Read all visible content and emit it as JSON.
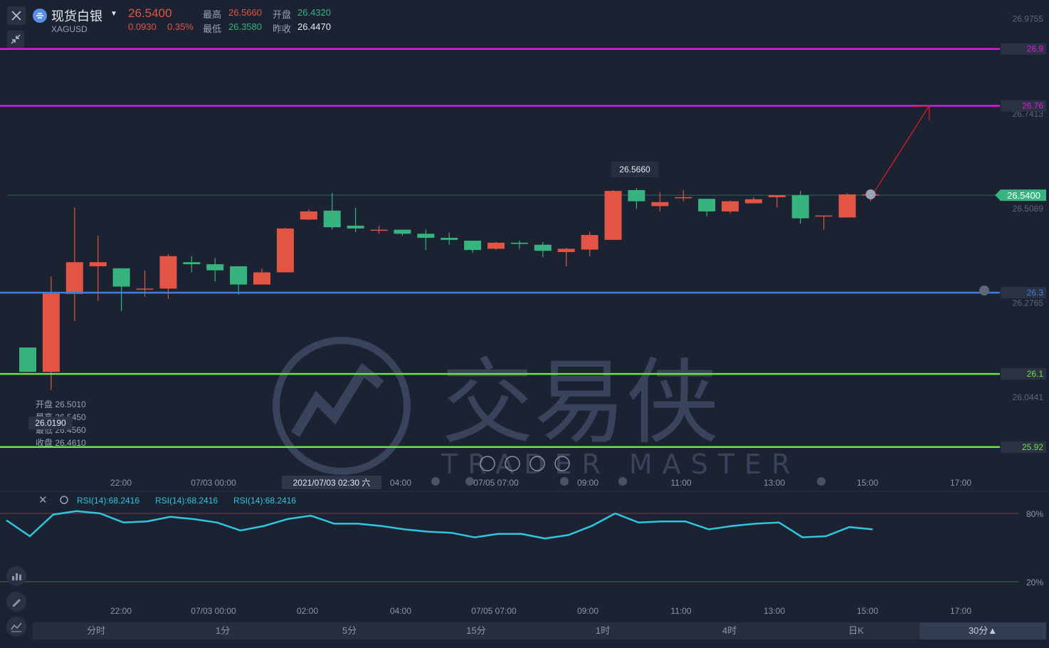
{
  "header": {
    "symbol_name": "现货白银",
    "symbol_code": "XAGUSD",
    "price": "26.5400",
    "change": "0.0930",
    "change_pct": "0.35%",
    "high_label": "最高",
    "high": "26.5660",
    "open_label": "开盘",
    "open": "26.4320",
    "low_label": "最低",
    "low": "26.3580",
    "prev_close_label": "昨收",
    "prev_close": "26.4470"
  },
  "colors": {
    "up": "#e25444",
    "down": "#36b37e",
    "bg": "#1b2232",
    "rsi": "#2fc6e0",
    "magenta": "#e01be0",
    "blue": "#3f7fe0",
    "green_line": "#6ee04a"
  },
  "watermark": {
    "cn": "交易侠",
    "en": "TRADER MASTER"
  },
  "chart_data": [
    {
      "type": "candlestick",
      "ylim": [
        25.85,
        26.99
      ],
      "y_ticks": [
        "26.9755",
        "26.7413",
        "26.5089",
        "26.2765",
        "26.0441"
      ],
      "x_ticks": [
        "22:00",
        "07/03 00:00",
        "04:00",
        "07/05 07:00",
        "09:00",
        "11:00",
        "13:00",
        "15:00",
        "17:00"
      ],
      "crosshair_time": "2021/07/03 02:30 六",
      "crosshair_price": "26.0190",
      "current_price": "26.5400",
      "max_label": "26.5660",
      "hover_ohlc": [
        {
          "label": "开盘",
          "value": "26.5010"
        },
        {
          "label": "最高",
          "value": "26.5450"
        },
        {
          "label": "最低",
          "value": "26.4560"
        },
        {
          "label": "收盘",
          "value": "26.4610"
        }
      ],
      "levels": [
        {
          "value": 26.9,
          "label": "26.9",
          "color": "#e01be0"
        },
        {
          "value": 26.76,
          "label": "26.76",
          "color": "#e01be0"
        },
        {
          "value": 26.3,
          "label": "26.3",
          "color": "#3f7fe0"
        },
        {
          "value": 26.1,
          "label": "26.1",
          "color": "#6ee04a"
        },
        {
          "value": 25.92,
          "label": "25.92",
          "color": "#6ee04a"
        }
      ],
      "candles": [
        [
          26.165,
          26.165,
          26.105,
          26.105
        ],
        [
          26.105,
          26.34,
          26.06,
          26.298
        ],
        [
          26.297,
          26.51,
          26.23,
          26.375
        ],
        [
          26.365,
          26.44,
          26.28,
          26.375
        ],
        [
          26.36,
          26.36,
          26.255,
          26.315
        ],
        [
          26.308,
          26.355,
          26.29,
          26.31
        ],
        [
          26.31,
          26.395,
          26.285,
          26.39
        ],
        [
          26.375,
          26.39,
          26.35,
          26.37
        ],
        [
          26.37,
          26.385,
          26.328,
          26.355
        ],
        [
          26.365,
          26.365,
          26.295,
          26.32
        ],
        [
          26.32,
          26.36,
          26.32,
          26.35
        ],
        [
          26.35,
          26.46,
          26.35,
          26.458
        ],
        [
          26.48,
          26.505,
          26.479,
          26.5
        ],
        [
          26.502,
          26.545,
          26.456,
          26.461
        ],
        [
          26.465,
          26.509,
          26.449,
          26.458
        ],
        [
          26.455,
          26.465,
          26.445,
          26.455
        ],
        [
          26.455,
          26.455,
          26.44,
          26.445
        ],
        [
          26.445,
          26.455,
          26.405,
          26.435
        ],
        [
          26.435,
          26.448,
          26.418,
          26.43
        ],
        [
          26.428,
          26.428,
          26.398,
          26.405
        ],
        [
          26.408,
          26.425,
          26.405,
          26.423
        ],
        [
          26.423,
          26.428,
          26.408,
          26.42
        ],
        [
          26.418,
          26.425,
          26.387,
          26.403
        ],
        [
          26.4,
          26.41,
          26.365,
          26.408
        ],
        [
          26.406,
          26.45,
          26.39,
          26.442
        ],
        [
          26.43,
          26.5525,
          26.43,
          26.5505
        ],
        [
          26.5525,
          26.5575,
          26.506,
          26.525
        ],
        [
          26.513,
          26.547,
          26.5,
          26.523
        ],
        [
          26.535,
          26.5525,
          26.525,
          26.535
        ],
        [
          26.531,
          26.531,
          26.488,
          26.5
        ],
        [
          26.5,
          26.527,
          26.495,
          26.525
        ],
        [
          26.52,
          26.535,
          26.52,
          26.53
        ],
        [
          26.535,
          26.54,
          26.51,
          26.54
        ],
        [
          26.54,
          26.55,
          26.47,
          26.483
        ],
        [
          26.49,
          26.49,
          26.455,
          26.49
        ],
        [
          26.485,
          26.545,
          26.485,
          26.542
        ],
        [
          26.54,
          26.545,
          26.525,
          26.542
        ]
      ],
      "projection": {
        "from": [
          36,
          26.542
        ],
        "to": [
          38.5,
          26.76
        ]
      }
    },
    {
      "type": "line",
      "name": "RSI(14):68.2416",
      "legend": [
        "RSI(14):68.2416",
        "RSI(14):68.2416",
        "RSI(14):68.2416"
      ],
      "ylim": [
        10,
        90
      ],
      "y_ticks": [
        "80%",
        "20%"
      ],
      "levels": [
        80,
        20
      ],
      "x_ticks": [
        "22:00",
        "07/03 00:00",
        "02:00",
        "04:00",
        "07/05 07:00",
        "09:00",
        "11:00",
        "13:00",
        "15:00",
        "17:00"
      ],
      "values": [
        74,
        60,
        79,
        82,
        80,
        72,
        73,
        77,
        75,
        72,
        65,
        69,
        75,
        78,
        71,
        71,
        69,
        66,
        64,
        63,
        59,
        62,
        62,
        58,
        61,
        69,
        80,
        72,
        73,
        73,
        66,
        69,
        71,
        72,
        59,
        60,
        68,
        66
      ]
    }
  ],
  "tabs": [
    "分时",
    "1分",
    "5分",
    "15分",
    "1时",
    "4时",
    "日K",
    "30分▲"
  ],
  "active_tab": 7
}
